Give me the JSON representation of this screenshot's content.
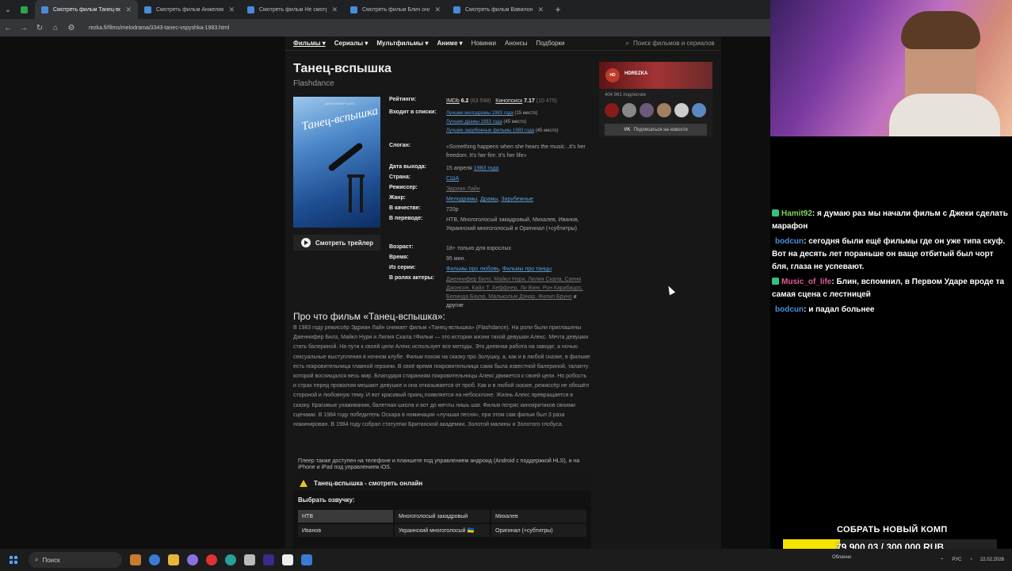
{
  "browser": {
    "tabs": [
      {
        "title": "Смотреть фильм Танец-вспышка",
        "active": true
      },
      {
        "title": "Смотреть фильм Анжелика, м",
        "active": false
      },
      {
        "title": "Смотреть фильм Не смотрите",
        "active": false
      },
      {
        "title": "Смотреть фильм Блич онлайн",
        "active": false
      },
      {
        "title": "Смотреть фильм Вавилон онл",
        "active": false
      }
    ],
    "new_tab": "+",
    "url": "rezka.fi/films/melodrama/3343-tanec-vspyshka-1983.html"
  },
  "site": {
    "menu": {
      "films": "Фильмы ▾",
      "series": "Сериалы ▾",
      "cartoons": "Мультфильмы ▾",
      "anime": "Аниме ▾",
      "new": "Новинки",
      "announces": "Анонсы",
      "collections": "Подборки",
      "search_placeholder": "Поиск фильмов и сериалов"
    },
    "film": {
      "title": "Танец-вспышка",
      "original_title": "Flashdance",
      "poster_title": "Танец-вспышка",
      "poster_names": "ДЖЕННИФЕР БИЛЗ",
      "trailer_label": "Смотреть трейлер"
    },
    "info": {
      "ratings_label": "Рейтинги:",
      "imdb_label": "IMDb",
      "imdb_value": "6.2",
      "imdb_votes": "(63 598)",
      "kp_label": "Кинопоиск",
      "kp_value": "7.17",
      "kp_votes": "(10 475)",
      "lists_label": "Входит в списки:",
      "list1": "Лучшие мелодрамы 1983 года",
      "list1_place": "(15 место)",
      "list2": "Лучшие драмы 1983 года",
      "list2_place": "(45 место)",
      "list3": "Лучшие зарубежные фильмы 1983 года",
      "list3_place": "(45 место)",
      "slogan_label": "Слоган:",
      "slogan": "«Something happens when she hears the music...it's her freedom. It's her fire. It's her life»",
      "release_label": "Дата выхода:",
      "release_date": "15 апреля",
      "release_year": "1983 года",
      "country_label": "Страна:",
      "country": "США",
      "director_label": "Режиссер:",
      "director": "Эдриан Лайн",
      "genre_label": "Жанр:",
      "genre1": "Мелодрамы",
      "genre2": "Драмы",
      "genre3": "Зарубежные",
      "quality_label": "В качестве:",
      "quality": "720p",
      "translation_label": "В переводе:",
      "translation": "НТВ, Многоголосый закадровый, Михалев, Иванов, Украинский многоголосый и Оригинал (+субтитры)",
      "age_label": "Возраст:",
      "age": "18+ только для взрослых",
      "time_label": "Время:",
      "time": "95 мин.",
      "series_label": "Из серии:",
      "series1": "Фильмы про любовь",
      "series2": "Фильмы про танцы",
      "actors_label": "В ролях актеры:",
      "actors": "Дженнифер Билз, Майкл Нури, Лилия Скала, Санни Джонсон, Кайл Т. Хеффнер, Ли Винг, Рон Карабацос, Белинда Бауэр, Малькольм Дэнар, Филип Бруно",
      "actors_more": "и другие"
    },
    "about": {
      "heading": "Про что фильм «Танец-вспышка»:",
      "text": "В 1983 году режиссёр Эдриан Лайн снимает фильм «Танец-вспышка» (Flashdance). На роли были приглашены Дженнифер Билз, Майкл Нури и Лилия Скала.тФильм — это истории жизни тихой девушки Алекс. Мечта девушки стать балериной. На пути к своей цели Алекс использует все методы. Это дневная работа на заводе, а ночью сексуальные выступления в ночном клубе. Фильм похож на сказку про Золушку, а, как и в любой сказке, в фильме есть покровительница главной героини. В своё время покровительница сама была известной балериной, таланту которой восхищался весь мир. Благодаря стараниям покровительницы Алекс движется к своей цели. Но робость и страх перед провалом мешают девушке и она отказывается от проб. Как и в любой сказке, режиссёр не обошёл стороной и любовную тему. И вот красивый принц появляется на небосклоне. Жизнь Алекс превращается в сказку. Красивые ухаживания, балетная школа и вот до мечты лишь шаг. Фильм потряс кинокритиков своими сценами. В 1984 году победитель Оскара в номинации «лучшая песня», при этом сам фильм был 3 раза номинирован. В 1984 году собрал статуэтки Британской академии, Золотой малины и Золотого глобуса."
    },
    "player": {
      "note": "Плеер также доступен на телефоне и планшете под управлением андроид (Android с поддержкой HLS), и на iPhone и iPad под управлением iOS.",
      "header": "Танец-вспышка - смотреть онлайн",
      "voice_label": "Выбрать озвучку:",
      "translations": [
        "НТВ",
        "Многоголосый закадровый",
        "Михалев",
        "Иванов",
        "Украинский многоголосый 🇺🇦",
        "Оригинал (+субтитры)"
      ],
      "active_index": 0
    },
    "promo": {
      "logo": "HD",
      "name": "HDREZKA",
      "subscribers": "404 961 подписчик",
      "subscribe": "Подписаться на новости",
      "vk": "VK"
    }
  },
  "stream": {
    "chat": [
      {
        "user": "Hamit92",
        "text": ": я думаю раз мы начали фильм с Джеки сделать марафон"
      },
      {
        "user": "bodcun",
        "text": ": сегодня были ещё фильмы где он уже типа скуф. Вот на десять лет пораньше он ваще отбитый был чорт бля, глаза не успевают."
      },
      {
        "user": "Music_of_life",
        "text": ": Блин, вспомнил, в Первом Ударе вроде та самая сцена с лестницей"
      },
      {
        "user": "bodcun",
        "text": ": и падал больнее"
      }
    ],
    "goal": {
      "title": "СОБРАТЬ НОВЫЙ КОМП",
      "text": "79 900.03 / 300 000 RUB",
      "current": 79900.03,
      "target": 300000
    }
  },
  "taskbar": {
    "search": "Поиск",
    "weather": "Облачно",
    "lang": "РУС",
    "date": "22.02.2026"
  },
  "colors": {
    "link": "#5b9bd5",
    "goal_fill": "#f5e400",
    "chat_user1": "#7fd45b",
    "chat_user2": "#4a8fe0",
    "chat_user3": "#e05d9a"
  }
}
